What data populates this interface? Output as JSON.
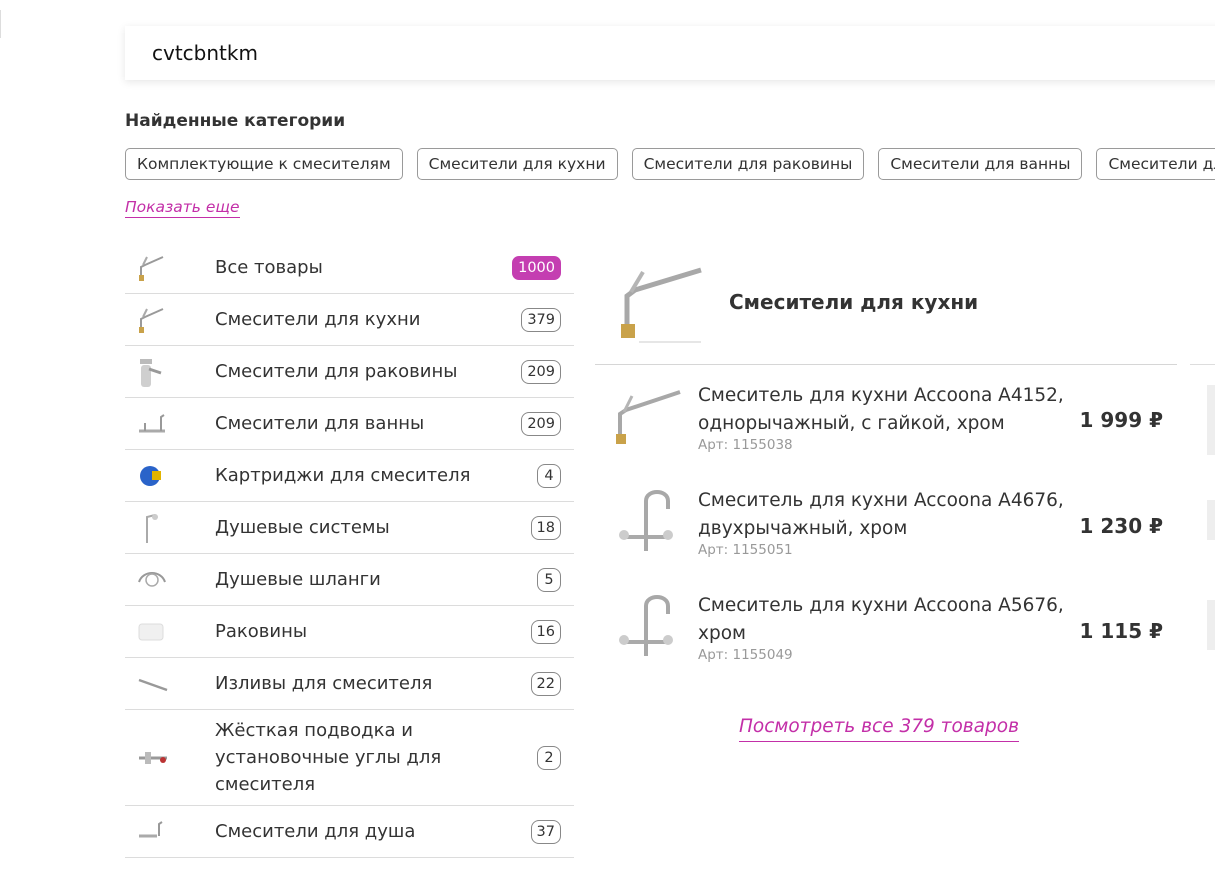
{
  "search": {
    "value": "cvtcbntkm"
  },
  "categories_title": "Найденные категории",
  "chips": [
    "Комплектующие к смесителям",
    "Смесители для кухни",
    "Смесители для раковины",
    "Смесители для ванны",
    "Смесители для"
  ],
  "show_more": "Показать еще",
  "categories": [
    {
      "label": "Все товары",
      "count": "1000",
      "icon": "faucet-icon"
    },
    {
      "label": "Смесители для кухни",
      "count": "379",
      "icon": "faucet-icon"
    },
    {
      "label": "Смесители для раковины",
      "count": "209",
      "icon": "basin-faucet-icon"
    },
    {
      "label": "Смесители для ванны",
      "count": "209",
      "icon": "bath-faucet-icon"
    },
    {
      "label": "Картриджи для смесителя",
      "count": "4",
      "icon": "cartridge-icon"
    },
    {
      "label": "Душевые системы",
      "count": "18",
      "icon": "shower-system-icon"
    },
    {
      "label": "Душевые шланги",
      "count": "5",
      "icon": "shower-hose-icon"
    },
    {
      "label": "Раковины",
      "count": "16",
      "icon": "sink-icon"
    },
    {
      "label": "Изливы для смесителя",
      "count": "22",
      "icon": "spout-icon"
    },
    {
      "label": "Жёсткая подводка и установочные углы для смесителя",
      "count": "2",
      "icon": "connector-icon"
    },
    {
      "label": "Смесители для душа",
      "count": "37",
      "icon": "shower-faucet-icon"
    }
  ],
  "panel": {
    "title": "Смесители для кухни",
    "products": [
      {
        "name": "Смеситель для кухни Accoona A4152, однорычажный, с гайкой, хром",
        "article": "Арт: 1155038",
        "price": "1 999 ₽"
      },
      {
        "name": "Смеситель для кухни Accoona A4676, двухрычажный, хром",
        "article": "Арт: 1155051",
        "price": "1 230 ₽"
      },
      {
        "name": "Смеситель для кухни Accoona A5676, хром",
        "article": "Арт: 1155049",
        "price": "1 115 ₽"
      }
    ],
    "view_all": "Посмотреть все 379 товаров"
  },
  "colors": {
    "accent": "#c43eb1",
    "link": "#c32fa8",
    "border": "#dcdcdc"
  }
}
